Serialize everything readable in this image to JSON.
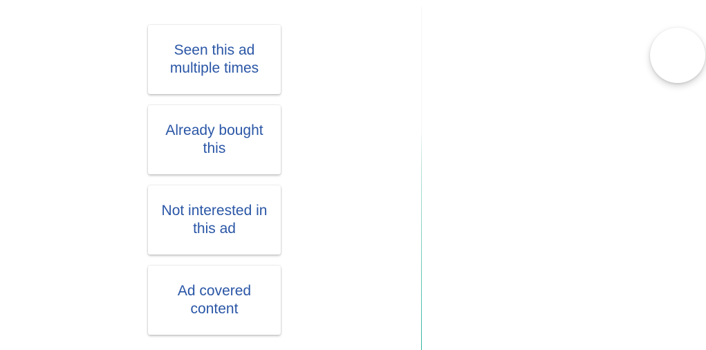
{
  "feedback": {
    "options": [
      {
        "label": "Seen this ad multiple times"
      },
      {
        "label": "Already bought this"
      },
      {
        "label": "Not interested in this ad"
      },
      {
        "label": "Ad covered content"
      }
    ]
  },
  "colors": {
    "option_text": "#2a56a6",
    "divider_accent": "#2fb5a0",
    "background": "#ffffff"
  },
  "icons": {
    "circle_button": "close-icon"
  }
}
